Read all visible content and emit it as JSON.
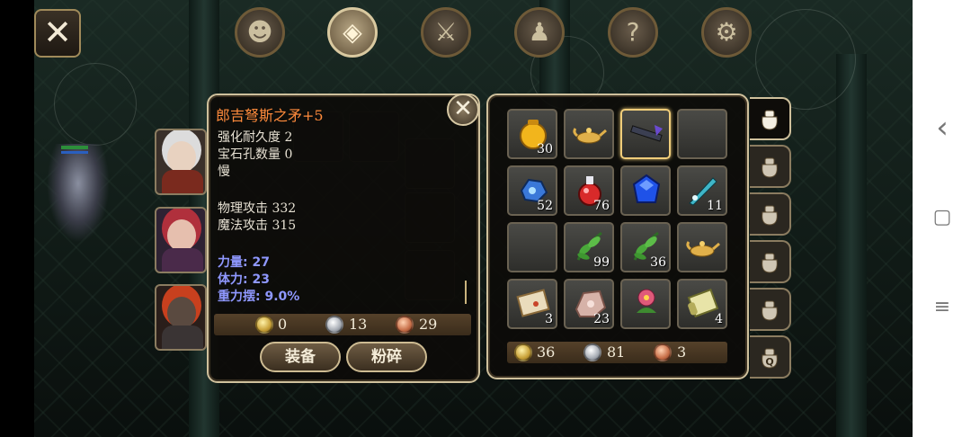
{
  "top_nav": {
    "close_glyph": "✕",
    "tabs": [
      {
        "name": "head-icon",
        "glyph": "☻"
      },
      {
        "name": "bag-icon",
        "glyph": "◈"
      },
      {
        "name": "sword-icon",
        "glyph": "⚔"
      },
      {
        "name": "party-icon",
        "glyph": "♟"
      },
      {
        "name": "quest-scroll-icon",
        "glyph": "?"
      },
      {
        "name": "gear-icon",
        "glyph": "⚙"
      }
    ],
    "active_index": 1
  },
  "tooltip": {
    "title": "郎吉弩斯之矛+5",
    "close_glyph": "✕",
    "lines": [
      "强化耐久度 2",
      "宝石孔数量 0",
      "慢"
    ],
    "attack_lines": [
      "物理攻击 332",
      "魔法攻击 315"
    ],
    "stat_lines": [
      "力量: 27",
      "体力: 23",
      "重力摆: 9.0%"
    ],
    "price": {
      "gold": "0",
      "silver": "13",
      "copper": "29"
    },
    "equip_label": "装备",
    "smash_label": "粉碎"
  },
  "bag": {
    "slots": [
      {
        "icon": "gold-pouch-icon",
        "count": "30",
        "selected": false
      },
      {
        "icon": "magic-lamp-icon",
        "count": "",
        "selected": false
      },
      {
        "icon": "spear-icon",
        "count": "",
        "selected": true
      },
      {
        "icon": "",
        "count": "",
        "selected": false
      },
      {
        "icon": "blue-ore-icon",
        "count": "52",
        "selected": false
      },
      {
        "icon": "red-potion-icon",
        "count": "76",
        "selected": false
      },
      {
        "icon": "sapphire-icon",
        "count": "",
        "selected": false
      },
      {
        "icon": "crystal-blade-icon",
        "count": "11",
        "selected": false
      },
      {
        "icon": "",
        "count": "",
        "selected": false
      },
      {
        "icon": "herb-leaf-icon",
        "count": "99",
        "selected": false
      },
      {
        "icon": "herb-leaf-icon",
        "count": "36",
        "selected": false
      },
      {
        "icon": "magic-lamp-icon",
        "count": "",
        "selected": false
      },
      {
        "icon": "treasure-map-icon",
        "count": "3",
        "selected": false
      },
      {
        "icon": "pink-ore-icon",
        "count": "23",
        "selected": false
      },
      {
        "icon": "flower-pot-icon",
        "count": "",
        "selected": false
      },
      {
        "icon": "scroll-icon",
        "count": "4",
        "selected": false
      }
    ],
    "money": {
      "gold": "36",
      "silver": "81",
      "copper": "3"
    }
  },
  "side_tabs": [
    {
      "name": "bag-page-1-icon",
      "active": true
    },
    {
      "name": "bag-page-2-icon",
      "active": false
    },
    {
      "name": "bag-page-3-icon",
      "active": false
    },
    {
      "name": "bag-page-4-icon",
      "active": false
    },
    {
      "name": "bag-page-5-icon",
      "active": false
    },
    {
      "name": "quest-bag-icon",
      "active": false
    }
  ],
  "quest_bag_letter": "Q",
  "system_nav": {
    "back": "‹",
    "home": "▢",
    "menu": "≡"
  },
  "colors": {
    "title_orange": "#ff8b3c",
    "stat_blue": "#8f98ff",
    "frame_gold": "#cfc09c"
  }
}
